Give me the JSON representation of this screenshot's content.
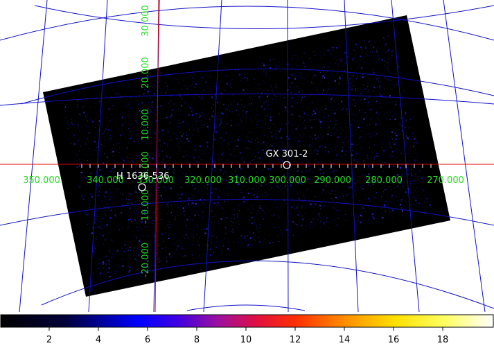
{
  "viewer": {
    "grid_color": "#1010c8",
    "crosshair_color": "#e00000",
    "label_color": "#22dd22",
    "frame_color": "#000000",
    "photon_color": "#1a1ad0"
  },
  "grid": {
    "longitude_labels": [
      "350.000",
      "340.000",
      "330.000",
      "320.000",
      "310.000",
      "300.000",
      "290.000",
      "280.000",
      "270.000"
    ],
    "latitude_labels": [
      "30.000",
      "20.000",
      "10.000",
      "0.000",
      "-10.000",
      "-20.000"
    ]
  },
  "sources": [
    {
      "name": "GX 301-2"
    },
    {
      "name": "H 1636-536"
    }
  ],
  "colorbar": {
    "colormap": "heat-b",
    "ticks": [
      "2",
      "4",
      "6",
      "8",
      "10",
      "12",
      "14",
      "16",
      "18"
    ]
  }
}
